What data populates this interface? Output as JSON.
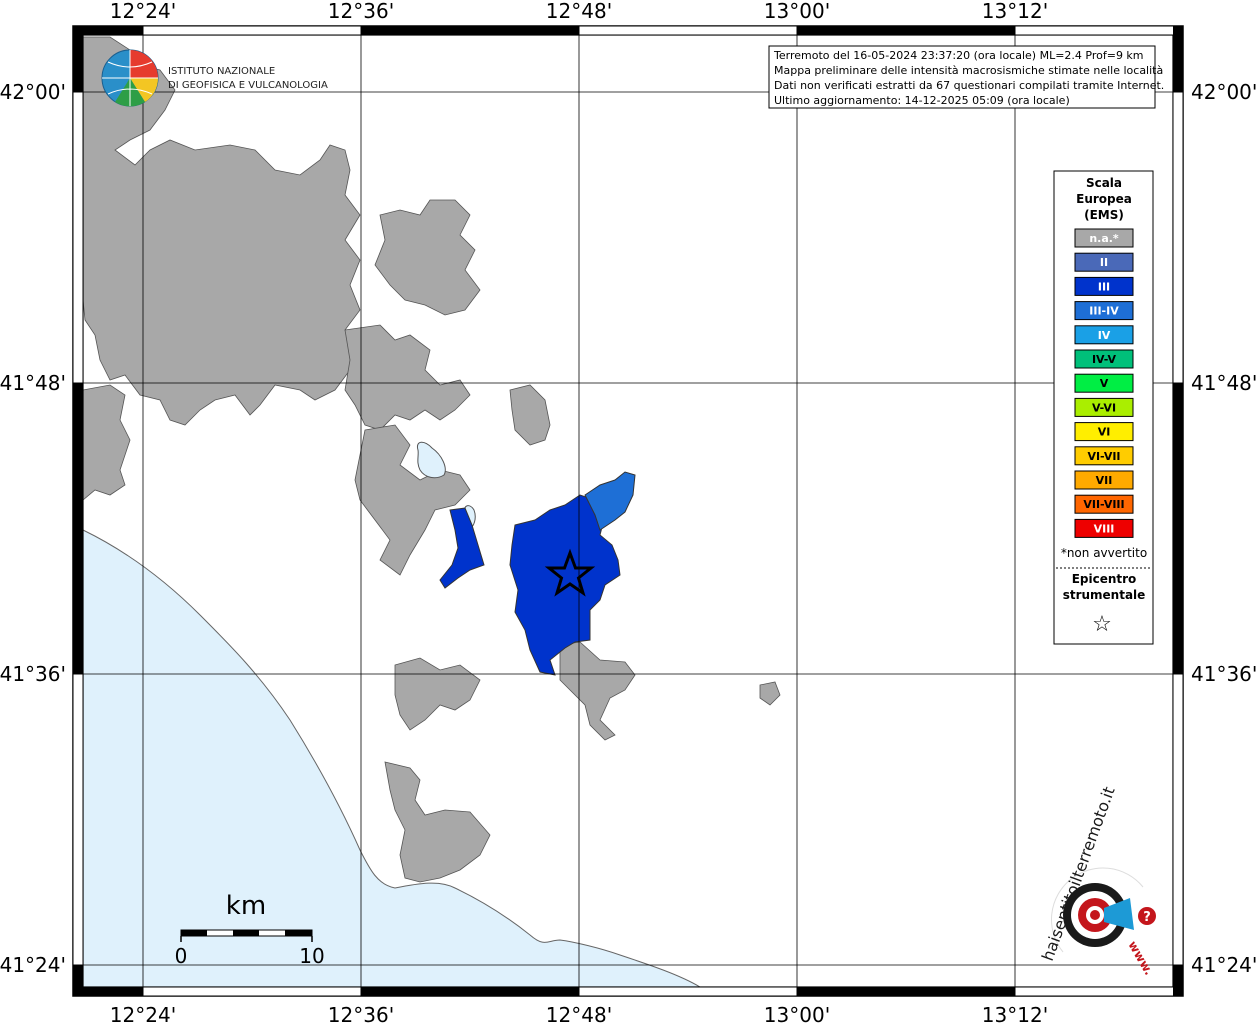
{
  "colors": {
    "sea": "#dff1fc",
    "urban": "#a8a8a8",
    "lake": "#dff1fc",
    "intensity_III": "#0033cc",
    "intensity_III_IV": "#1e6fd6"
  },
  "axes": {
    "top_labels": [
      "12°24'",
      "12°36'",
      "12°48'",
      "13°00'",
      "13°12'"
    ],
    "bottom_labels": [
      "12°24'",
      "12°36'",
      "12°48'",
      "13°00'",
      "13°12'"
    ],
    "left_labels": [
      "42°00'",
      "41°48'",
      "41°36'",
      "41°24'"
    ],
    "right_labels": [
      "42°00'",
      "41°48'",
      "41°36'",
      "41°24'"
    ]
  },
  "info_box": {
    "line1": "Terremoto del 16-05-2024 23:37:20 (ora locale) ML=2.4 Prof=9 km",
    "line2": "Mappa preliminare delle intensità macrosismiche stimate nelle località",
    "line3": "Dati non verificati estratti da 67 questionari compilati tramite Internet.",
    "line4": "Ultimo aggiornamento: 14-12-2025 05:09 (ora locale)"
  },
  "ingv_logo": {
    "line1": "ISTITUTO NAZIONALE",
    "line2": "DI GEOFISICA E VULCANOLOGIA"
  },
  "legend": {
    "title1": "Scala",
    "title2": "Europea",
    "title3": "(EMS)",
    "items": [
      {
        "label": "n.a.*",
        "color": "#a8a8a8",
        "text_color": "#ffffff"
      },
      {
        "label": "II",
        "color": "#4a69b8",
        "text_color": "#ffffff"
      },
      {
        "label": "III",
        "color": "#0033cc",
        "text_color": "#ffffff"
      },
      {
        "label": "III-IV",
        "color": "#1e6fd6",
        "text_color": "#ffffff"
      },
      {
        "label": "IV",
        "color": "#1aa0e6",
        "text_color": "#ffffff"
      },
      {
        "label": "IV-V",
        "color": "#00c07a",
        "text_color": "#000000"
      },
      {
        "label": "V",
        "color": "#00ee44",
        "text_color": "#000000"
      },
      {
        "label": "V-VI",
        "color": "#aaee00",
        "text_color": "#000000"
      },
      {
        "label": "VI",
        "color": "#ffee00",
        "text_color": "#000000"
      },
      {
        "label": "VI-VII",
        "color": "#ffcc00",
        "text_color": "#000000"
      },
      {
        "label": "VII",
        "color": "#ffaa00",
        "text_color": "#000000"
      },
      {
        "label": "VII-VIII",
        "color": "#ff6600",
        "text_color": "#000000"
      },
      {
        "label": "VIII",
        "color": "#ee0000",
        "text_color": "#ffffff"
      }
    ],
    "footnote": "*non avvertito",
    "epicenter_title1": "Epicentro",
    "epicenter_title2": "strumentale",
    "epicenter_symbol": "☆"
  },
  "scale_bar": {
    "unit": "km",
    "start": "0",
    "end": "10"
  },
  "hsit_logo": {
    "text_main": "haisentitoilterremoto.it",
    "text_www": "www."
  }
}
